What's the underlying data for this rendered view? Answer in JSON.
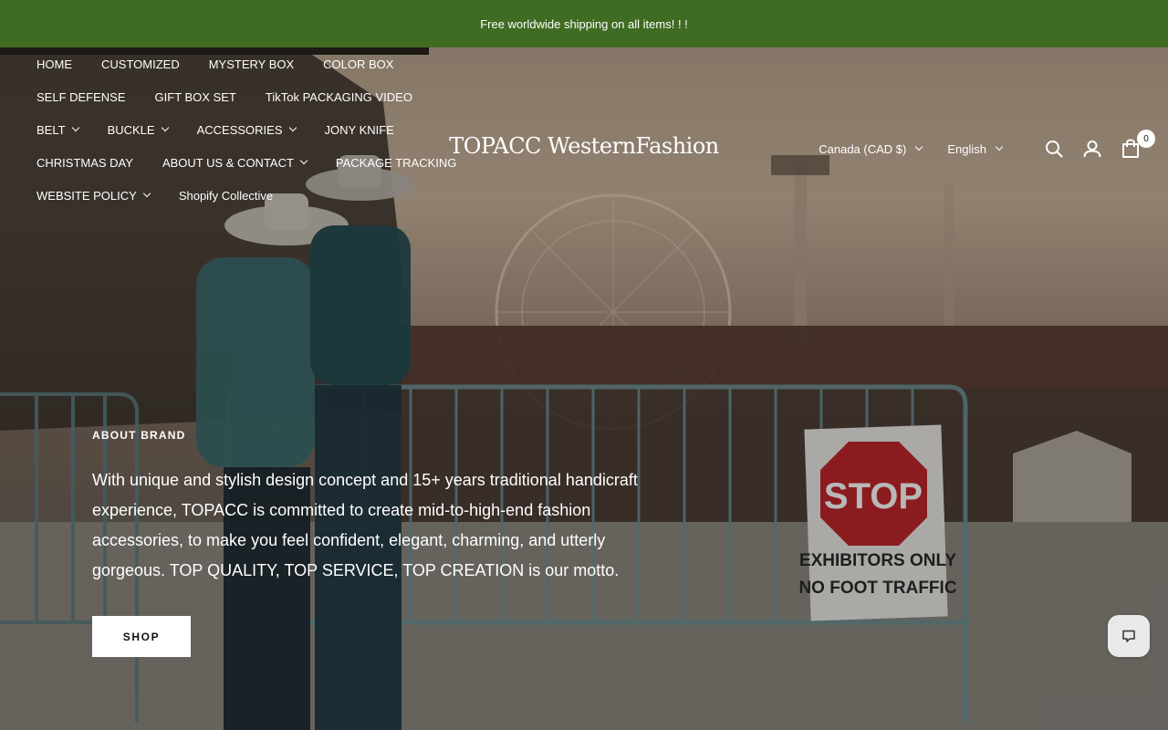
{
  "announcement": {
    "text": "Free worldwide shipping on all items! ! !"
  },
  "brand": {
    "logo": "TOPACC WesternFashion"
  },
  "nav": {
    "rows": [
      [
        {
          "label": "HOME",
          "dropdown": false
        },
        {
          "label": "CUSTOMIZED",
          "dropdown": false
        },
        {
          "label": "MYSTERY BOX",
          "dropdown": false
        },
        {
          "label": "COLOR BOX",
          "dropdown": false
        }
      ],
      [
        {
          "label": "SELF DEFENSE",
          "dropdown": false
        },
        {
          "label": "GIFT BOX SET",
          "dropdown": false
        },
        {
          "label": "TikTok PACKAGING VIDEO",
          "dropdown": false
        }
      ],
      [
        {
          "label": "BELT",
          "dropdown": true
        },
        {
          "label": "BUCKLE",
          "dropdown": true
        },
        {
          "label": "ACCESSORIES",
          "dropdown": true
        },
        {
          "label": "JONY KNIFE",
          "dropdown": false
        }
      ],
      [
        {
          "label": "CHRISTMAS DAY",
          "dropdown": false
        },
        {
          "label": "ABOUT US & CONTACT",
          "dropdown": true
        },
        {
          "label": "PACKAGE TRACKING",
          "dropdown": false
        }
      ],
      [
        {
          "label": "WEBSITE POLICY",
          "dropdown": true
        },
        {
          "label": "Shopify Collective",
          "dropdown": false
        }
      ]
    ]
  },
  "header": {
    "country": "Canada (CAD $)",
    "language": "English",
    "cart_count": "0",
    "icons": {
      "search": "search-icon",
      "account": "account-icon",
      "cart": "cart-icon"
    }
  },
  "about": {
    "eyebrow": "ABOUT BRAND",
    "text": "With unique and stylish design concept and 15+ years traditional handicraft experience, TOPACC is committed to create mid-to-high-end fashion accessories, to make you feel confident, elegant, charming, and utterly gorgeous. TOP QUALITY, TOP SERVICE, TOP CREATION is our motto.",
    "button": "SHOP"
  },
  "hero_sign": {
    "stop": "STOP",
    "line1": "EXHIBITORS ONLY",
    "line2": "NO FOOT TRAFFIC"
  },
  "colors": {
    "announcement_bg": "#3f6b22",
    "text": "#ffffff",
    "stop_red": "#c0282b"
  }
}
